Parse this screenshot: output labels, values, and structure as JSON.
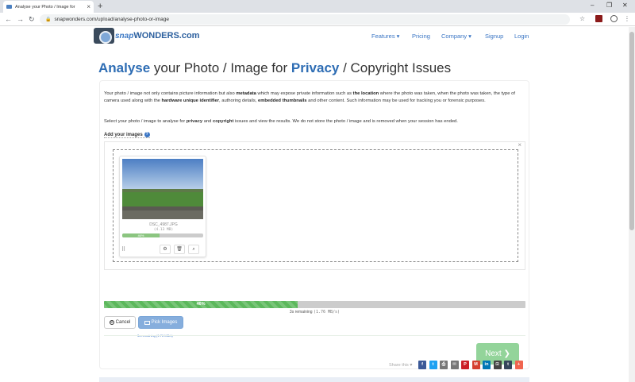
{
  "browser": {
    "tab_title": "Analyse your Photo / Image for",
    "new_tab": "+",
    "url": "snapwonders.com/upload/analyse-photo-or-image"
  },
  "site": {
    "logo_snap": "snap",
    "logo_wonders": "WONDERS.com"
  },
  "nav": {
    "features": "Features ▾",
    "pricing": "Pricing",
    "company": "Company ▾",
    "signup": "Signup",
    "login": "Login"
  },
  "heading": {
    "w1": "Analyse",
    "w2": " your Photo / Image for ",
    "w3": "Privacy",
    "w4": " / Copyright Issues"
  },
  "intro": {
    "p1a": "Your photo / image not only contains picture information but also ",
    "p1b": "metadata",
    "p1c": " which may expose private information such as ",
    "p1d": "the location",
    "p1e": " where the photo was taken, when the photo was taken, the type of camera used along with the ",
    "p1f": "hardware unique identifier",
    "p1g": ", authoring details, ",
    "p1h": "embedded thumbnails",
    "p1i": " and other content. Such information may be used for tracking you or forensic purposes.",
    "p2a": "Select your photo / image to analyse for ",
    "p2b": "privacy",
    "p2c": " and ",
    "p2d": "copyright",
    "p2e": " issues and view the results. We do not store the photo / image and is removed when your session has ended."
  },
  "upload": {
    "add_label": "Add your images",
    "help": "?",
    "close": "×",
    "file_name": "DSC_4987.JPG",
    "file_size": "(4.13 MB)",
    "file_percent": "46%",
    "file_progress": 0.46,
    "file_remaining": "3s remaining (1.76 MB/s)"
  },
  "progress": {
    "percent_label": "46%",
    "value": 0.46,
    "remaining": "3s remaining",
    "speed": "(1.76 MB/s)"
  },
  "buttons": {
    "cancel": "Cancel",
    "pick": "Pick Images",
    "next": "Next ❯"
  },
  "share": {
    "label": "Share this ♥",
    "items": [
      {
        "name": "facebook",
        "glyph": "f",
        "color": "#3b5998"
      },
      {
        "name": "twitter",
        "glyph": "t",
        "color": "#1da1f2"
      },
      {
        "name": "print",
        "glyph": "⎙",
        "color": "#777777"
      },
      {
        "name": "email",
        "glyph": "✉",
        "color": "#777777"
      },
      {
        "name": "pinterest",
        "glyph": "P",
        "color": "#cb2027"
      },
      {
        "name": "gmail",
        "glyph": "M",
        "color": "#d54030"
      },
      {
        "name": "linkedin",
        "glyph": "in",
        "color": "#0077b5"
      },
      {
        "name": "pdf",
        "glyph": "⊡",
        "color": "#444444"
      },
      {
        "name": "tumblr",
        "glyph": "t",
        "color": "#35465c"
      },
      {
        "name": "more",
        "glyph": "+",
        "color": "#f0654f"
      }
    ]
  },
  "colors": {
    "brand_blue": "#2e6db4",
    "link_blue": "#3a75c4",
    "progress_green": "#5cb85c",
    "next_green": "#93d49a"
  }
}
